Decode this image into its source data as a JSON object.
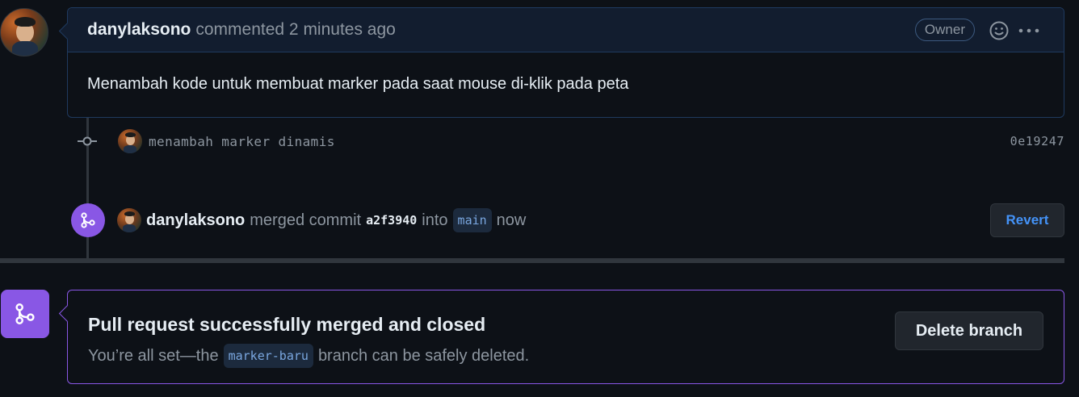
{
  "comment": {
    "author": "danylaksono",
    "meta": "commented 2 minutes ago",
    "badge": "Owner",
    "body": "Menambah kode untuk membuat marker pada saat mouse di-klik pada peta"
  },
  "commit": {
    "message": "menambah marker dinamis",
    "sha": "0e19247"
  },
  "merge_event": {
    "author": "danylaksono",
    "action": "merged commit",
    "sha": "a2f3940",
    "into": "into",
    "branch": "main",
    "when": "now",
    "revert_label": "Revert"
  },
  "merged_box": {
    "title": "Pull request successfully merged and closed",
    "sub_before": "You’re all set—the",
    "branch": "marker-baru",
    "sub_after": "branch can be safely deleted.",
    "delete_label": "Delete branch"
  },
  "colors": {
    "merge_purple": "#8957e5",
    "link_blue": "#4493f8",
    "header_bg": "#121d2f"
  }
}
